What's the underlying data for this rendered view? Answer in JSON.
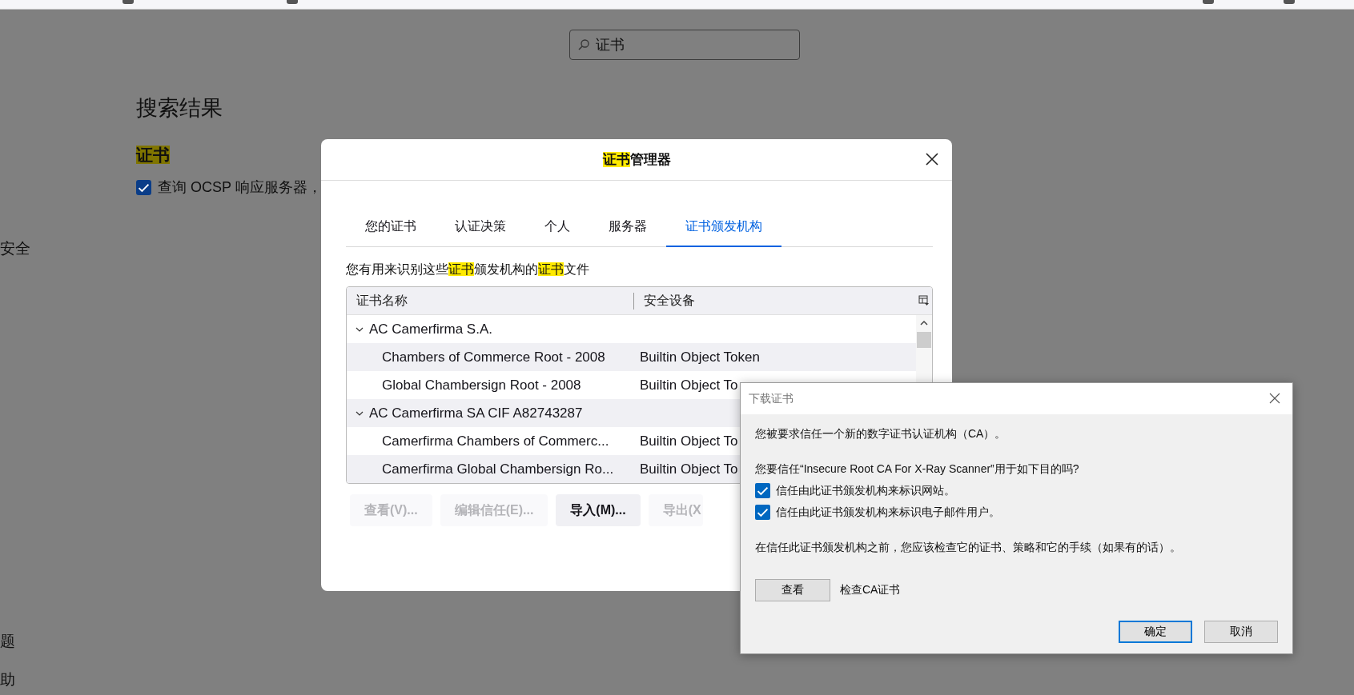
{
  "search": {
    "value": "证书"
  },
  "sidebar": {
    "items": [
      {
        "label": "安全"
      },
      {
        "label": "题"
      },
      {
        "label": "助"
      }
    ]
  },
  "results": {
    "heading": "搜索结果",
    "section": [
      {
        "text": "证书",
        "highlight": true
      }
    ],
    "option": {
      "label": "查询 OCSP 响应服务器，",
      "checked": true
    }
  },
  "cert_manager": {
    "title": [
      {
        "text": "证书",
        "highlight": true
      },
      {
        "text": "管理器",
        "highlight": false
      }
    ],
    "tabs": [
      {
        "label": "您的证书",
        "selected": false
      },
      {
        "label": "认证决策",
        "selected": false
      },
      {
        "label": "个人",
        "selected": false
      },
      {
        "label": "服务器",
        "selected": false
      },
      {
        "label": "证书颁发机构",
        "selected": true
      }
    ],
    "description": [
      {
        "text": "您有用来识别这些",
        "highlight": false
      },
      {
        "text": "证书",
        "highlight": true
      },
      {
        "text": "颁发机构的",
        "highlight": false
      },
      {
        "text": "证书",
        "highlight": true
      },
      {
        "text": "文件",
        "highlight": false
      }
    ],
    "table": {
      "columns": [
        "证书名称",
        "安全设备"
      ],
      "rows": [
        {
          "name": "AC Camerfirma S.A.",
          "expanded": true,
          "children": [
            {
              "name": "Chambers of Commerce Root - 2008",
              "device": "Builtin Object Token"
            },
            {
              "name": "Global Chambersign Root - 2008",
              "device": "Builtin Object To"
            }
          ]
        },
        {
          "name": "AC Camerfirma SA CIF A82743287",
          "expanded": true,
          "children": [
            {
              "name": "Camerfirma Chambers of Commerc...",
              "device": "Builtin Object To"
            },
            {
              "name": "Camerfirma Global Chambersign Ro...",
              "device": "Builtin Object To"
            }
          ]
        }
      ]
    },
    "buttons": [
      {
        "label": "查看(V)...",
        "disabled": true
      },
      {
        "label": "编辑信任(E)...",
        "disabled": true
      },
      {
        "label": "导入(M)...",
        "disabled": false
      },
      {
        "label": "导出(X",
        "disabled": true
      }
    ]
  },
  "download_dialog": {
    "title": "下载证书",
    "message": "您被要求信任一个新的数字证书认证机构（CA）。",
    "question": "您要信任“Insecure Root CA For X-Ray Scanner”用于如下目的吗?",
    "options": [
      {
        "label": "信任由此证书颁发机构来标识网站。",
        "checked": true
      },
      {
        "label": "信任由此证书颁发机构来标识电子邮件用户。",
        "checked": true
      }
    ],
    "advice": "在信任此证书颁发机构之前，您应该检查它的证书、策略和它的手续（如果有的话）。",
    "view_button": "查看",
    "view_label": "检查CA证书",
    "ok_button": "确定",
    "cancel_button": "取消"
  }
}
